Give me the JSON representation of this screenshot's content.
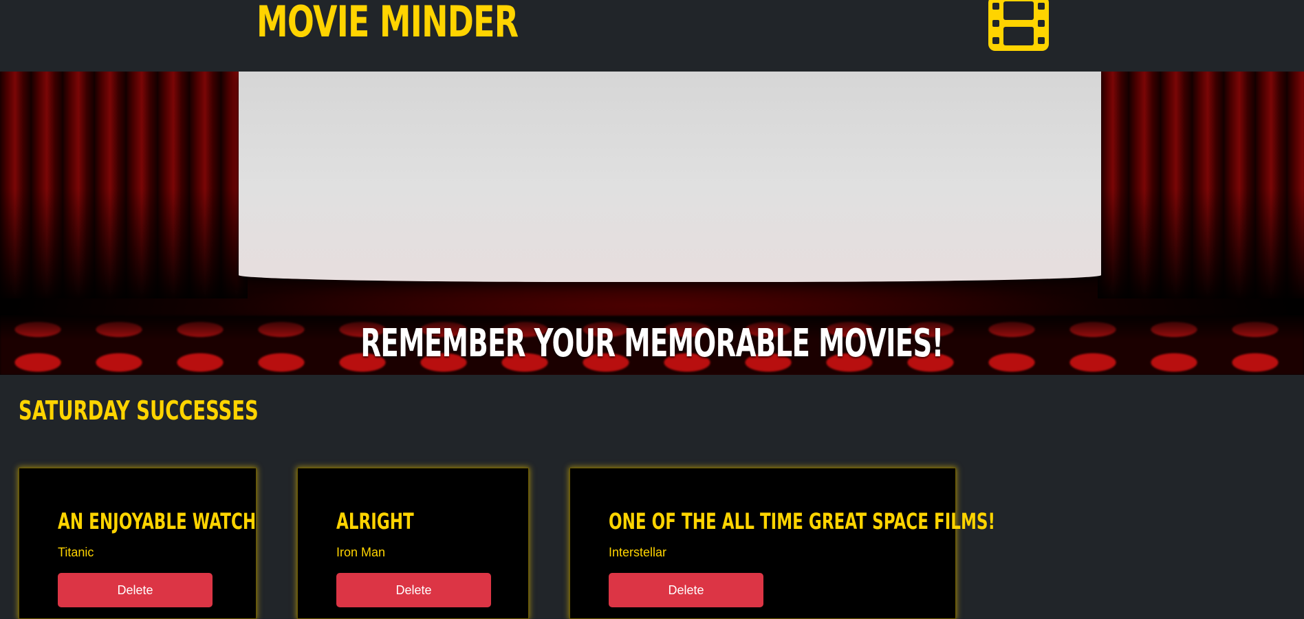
{
  "header": {
    "brand": "MOVIE MINDER",
    "icon": "film-icon",
    "brand_color": "#ffd400",
    "background_color": "#212529"
  },
  "hero": {
    "tagline": "REMEMBER YOUR MEMORABLE MOVIES!",
    "image": "cinema-screen-with-red-curtains-and-seats"
  },
  "section": {
    "title": "SATURDAY SUCCESSES"
  },
  "cards": [
    {
      "title": "AN ENJOYABLE WATCH",
      "movie": "Titanic",
      "delete_label": "Delete"
    },
    {
      "title": "ALRIGHT",
      "movie": "Iron Man",
      "delete_label": "Delete"
    },
    {
      "title": "ONE OF THE ALL TIME GREAT SPACE FILMS!",
      "movie": "Interstellar",
      "delete_label": "Delete"
    }
  ],
  "colors": {
    "accent": "#ffd400",
    "danger": "#dc3545",
    "card_background": "#000000"
  }
}
